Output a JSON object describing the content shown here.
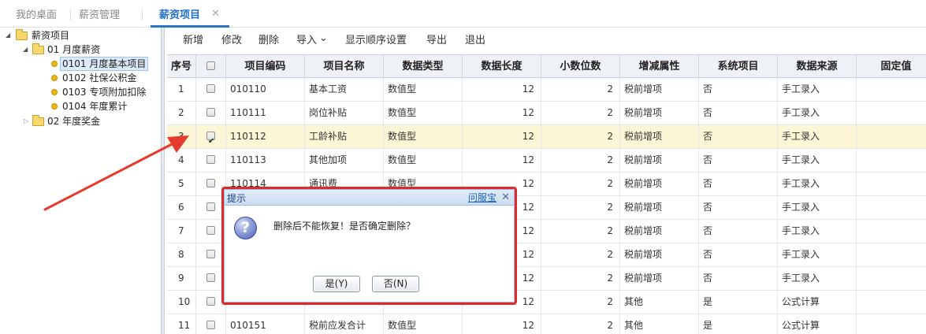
{
  "tabs": [
    {
      "label": "我的桌面"
    },
    {
      "label": "薪资管理"
    },
    {
      "label": "薪资项目"
    }
  ],
  "tab_close": "✕",
  "tree": {
    "root": "薪资项目",
    "n1": "01 月度薪资",
    "n1_children": [
      "0101 月度基本项目",
      "0102 社保公积金",
      "0103 专项附加扣除",
      "0104 年度累计"
    ],
    "n2": "02 年度奖金"
  },
  "toolbar": {
    "add": "新增",
    "edit": "修改",
    "delete": "删除",
    "import": "导入",
    "import_caret": "⌄",
    "display_order": "显示顺序设置",
    "export": "导出",
    "exit": "退出"
  },
  "grid": {
    "columns": [
      "序号",
      "项目编码",
      "项目名称",
      "数据类型",
      "数据长度",
      "小数位数",
      "增减属性",
      "系统项目",
      "数据来源",
      "固定值"
    ],
    "rows": [
      {
        "idx": "1",
        "code": "010110",
        "name": "基本工资",
        "type": "数值型",
        "len": "12",
        "dec": "2",
        "attr": "税前增项",
        "sys": "否",
        "src": "手工录入",
        "checked": false
      },
      {
        "idx": "2",
        "code": "110111",
        "name": "岗位补贴",
        "type": "数值型",
        "len": "12",
        "dec": "2",
        "attr": "税前增项",
        "sys": "否",
        "src": "手工录入",
        "checked": false
      },
      {
        "idx": "3",
        "code": "110112",
        "name": "工龄补贴",
        "type": "数值型",
        "len": "12",
        "dec": "2",
        "attr": "税前增项",
        "sys": "否",
        "src": "手工录入",
        "checked": true
      },
      {
        "idx": "4",
        "code": "110113",
        "name": "其他加项",
        "type": "数值型",
        "len": "12",
        "dec": "2",
        "attr": "税前增项",
        "sys": "否",
        "src": "手工录入",
        "checked": false
      },
      {
        "idx": "5",
        "code": "110114",
        "name": "通讯费",
        "type": "数值型",
        "len": "12",
        "dec": "2",
        "attr": "税前增项",
        "sys": "否",
        "src": "手工录入",
        "checked": false
      },
      {
        "idx": "6",
        "code": "",
        "name": "",
        "type": "",
        "len": "12",
        "dec": "2",
        "attr": "税前增项",
        "sys": "否",
        "src": "手工录入",
        "checked": false
      },
      {
        "idx": "7",
        "code": "",
        "name": "",
        "type": "",
        "len": "12",
        "dec": "2",
        "attr": "税前增项",
        "sys": "否",
        "src": "手工录入",
        "checked": false
      },
      {
        "idx": "8",
        "code": "",
        "name": "",
        "type": "",
        "len": "12",
        "dec": "2",
        "attr": "税前增项",
        "sys": "否",
        "src": "手工录入",
        "checked": false
      },
      {
        "idx": "9",
        "code": "",
        "name": "",
        "type": "",
        "len": "12",
        "dec": "2",
        "attr": "税前增项",
        "sys": "否",
        "src": "手工录入",
        "checked": false
      },
      {
        "idx": "10",
        "code": "",
        "name": "",
        "type": "",
        "len": "12",
        "dec": "2",
        "attr": "其他",
        "sys": "是",
        "src": "公式计算",
        "checked": false
      },
      {
        "idx": "11",
        "code": "010151",
        "name": "税前应发合计",
        "type": "数值型",
        "len": "12",
        "dec": "2",
        "attr": "其他",
        "sys": "是",
        "src": "公式计算",
        "checked": false
      }
    ]
  },
  "dialog": {
    "title": "提示",
    "help": "问服宝",
    "close": "✕",
    "icon": "?",
    "message": "删除后不能恢复！是否确定删除？",
    "yes": "是(Y)",
    "no": "否(N)"
  },
  "colors": {
    "accent": "#2b78c2",
    "selected_row": "#fcf5d6",
    "highlight_red": "#e02a2a"
  }
}
